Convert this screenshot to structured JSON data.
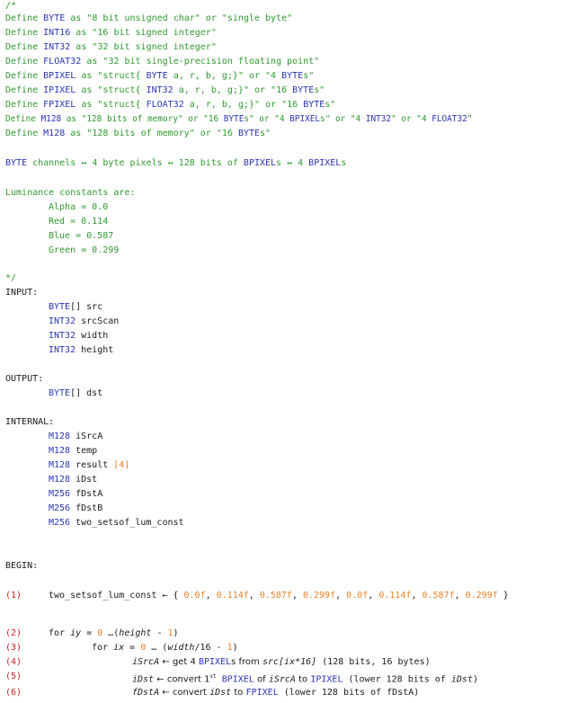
{
  "comment_open": "/*",
  "defines": [
    {
      "kw": "Define",
      "sym": "BYTE",
      "as": "as",
      "desc": "\"8 bit unsigned char\" or \"single byte\""
    },
    {
      "kw": "Define",
      "sym": "INT16",
      "as": "as",
      "desc": "\"16 bit signed integer\""
    },
    {
      "kw": "Define",
      "sym": "INT32",
      "as": "as",
      "desc": "\"32 bit signed integer\""
    },
    {
      "kw": "Define",
      "sym": "FLOAT32",
      "as": "as",
      "desc": "\"32 bit single-precision floating point\""
    },
    {
      "kw": "Define",
      "sym": "BPIXEL",
      "as": "as",
      "desc_a": "\"struct{ ",
      "t": "BYTE",
      "desc_b": " a, r, b, g;}\" or \"4 ",
      "t2": "BYTE",
      "desc_c": "s\""
    },
    {
      "kw": "Define",
      "sym": "IPIXEL",
      "as": "as",
      "desc_a": "\"struct{ ",
      "t": "INT32",
      "desc_b": " a, r, b, g;}\" or \"16 ",
      "t2": "BYTE",
      "desc_c": "s\""
    },
    {
      "kw": "Define",
      "sym": "FPIXEL",
      "as": "as",
      "desc_a": "\"struct{ ",
      "t": "FLOAT32",
      "desc_b": " a, r, b, g;}\" or \"16 ",
      "t2": "BYTE",
      "desc_c": "s\""
    },
    {
      "kw": "Define",
      "sym": "M128",
      "as": "as",
      "long": [
        "\"128 bits of memory\" or \"16 ",
        "BYTE",
        "s\" or \"4 ",
        "BPIXEL",
        "s\" or \"4 ",
        "INT32",
        "\" or \"4 ",
        "FLOAT32",
        "\""
      ]
    },
    {
      "kw": "Define",
      "sym": "M128",
      "as": "as",
      "desc_a": "\"128 bits of memory\" or \"16 ",
      "t": "BYTE",
      "desc_b": "s\""
    }
  ],
  "channels_line": {
    "a": "BYTE",
    "b": " channels ↔ 4 byte pixels ↔ 128 bits of ",
    "c": "BPIXEL",
    "d": "s ↔ 4 ",
    "e": "BPIXEL",
    "f": "s"
  },
  "lum_title": "Luminance constants are:",
  "lum": [
    "Alpha = 0.0",
    "Red = 0.114",
    "Blue = 0.587",
    "Green = 0.299"
  ],
  "comment_close": "*/",
  "input_label": "INPUT:",
  "inputs": [
    {
      "type": "BYTE",
      "rest": "[] src"
    },
    {
      "type": "INT32",
      "rest": " srcScan"
    },
    {
      "type": "INT32",
      "rest": " width"
    },
    {
      "type": "INT32",
      "rest": " height"
    }
  ],
  "output_label": "OUTPUT:",
  "outputs": [
    {
      "type": "BYTE",
      "rest": "[] dst"
    }
  ],
  "internal_label": "INTERNAL:",
  "internals": [
    {
      "type": "M128",
      "name": " iSrcA",
      "idx": ""
    },
    {
      "type": "M128",
      "name": " temp",
      "idx": ""
    },
    {
      "type": "M128",
      "name": " result ",
      "idx": "[4]"
    },
    {
      "type": "M128",
      "name": " iDst",
      "idx": ""
    },
    {
      "type": "M256",
      "name": " fDstA",
      "idx": ""
    },
    {
      "type": "M256",
      "name": " fDstB",
      "idx": ""
    },
    {
      "type": "M256",
      "name": " two_setsof_lum_const",
      "idx": ""
    }
  ],
  "begin_label": "BEGIN:",
  "steps": {
    "s1": {
      "num": "(1)",
      "pre": "two_setsof_lum_const ← { ",
      "vals": [
        "0.0f",
        "0.114f",
        "0.587f",
        "0.299f",
        "0.0f",
        "0.114f",
        "0.587f",
        "0.299f"
      ],
      "sep": ", ",
      "post": " }"
    },
    "s2": {
      "num": "(2)",
      "a": "for ",
      "b": "iy",
      "c": " = ",
      "d": "0",
      "e": " …(",
      "f": "height",
      "g": " - ",
      "h": "1",
      "i": ")"
    },
    "s3": {
      "num": "(3)",
      "a": "for ",
      "b": "ix",
      "c": " = ",
      "d": "0",
      "e": " … (",
      "f": "width",
      "g": "/16 - ",
      "h": "1",
      "i": ")"
    },
    "s4": {
      "num": "(4)",
      "a": "iSrcA",
      "b": " ← get 4 ",
      "c": "BPIXEL",
      "d": "s from ",
      "e": "src[ix*16]",
      "f": " (128 bits, 16 bytes)"
    },
    "s5": {
      "num": "(5)",
      "a": "iDst",
      "b": " ← convert 1",
      "sup": "st",
      "c": " ",
      "d": "BPIXEL",
      "e": " of ",
      "f": "iSrcA",
      "g": " to ",
      "h": "IPIXEL",
      "i": " (lower 128 bits of ",
      "j": "iDst",
      "k": ")"
    },
    "s6": {
      "num": "(6)",
      "a": "fDstA",
      "b": " ← convert ",
      "c": "iDst",
      "d": " to ",
      "e": "FPIXEL",
      "f": " (lower 128 bits of fDstA)"
    }
  }
}
